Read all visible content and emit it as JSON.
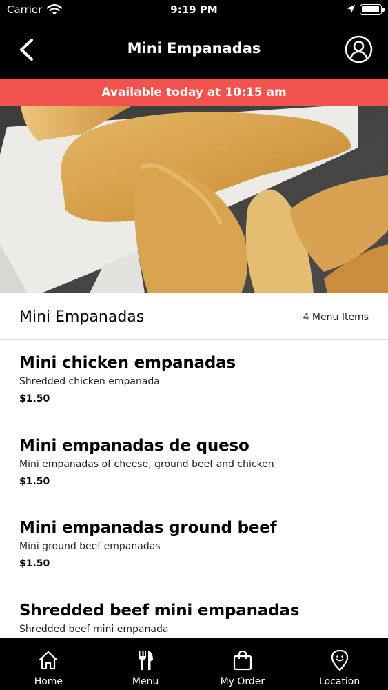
{
  "status_bar": {
    "carrier": "Carrier",
    "time": "9:19 PM"
  },
  "nav": {
    "title": "Mini Empanadas",
    "back_icon": "chevron-left-icon",
    "profile_icon": "user-circle-icon"
  },
  "banner": {
    "text": "Available today at 10:15 am",
    "color": "#f2534f"
  },
  "section": {
    "title": "Mini Empanadas",
    "count": "4 Menu Items"
  },
  "items": [
    {
      "name": "Mini chicken empanadas",
      "description": "Shredded chicken empanada",
      "price": "$1.50"
    },
    {
      "name": "Mini empanadas de queso",
      "description": "Mini empanadas of cheese, ground beef and chicken",
      "price": "$1.50"
    },
    {
      "name": "Mini empanadas ground beef",
      "description": "Mini ground beef empanadas",
      "price": "$1.50"
    },
    {
      "name": "Shredded beef mini empanadas",
      "description": "Shredded beef mini empanada",
      "price": ""
    }
  ],
  "tabs": [
    {
      "label": "Home",
      "icon": "home-icon"
    },
    {
      "label": "Menu",
      "icon": "fork-knife-icon"
    },
    {
      "label": "My Order",
      "icon": "shopping-bag-icon"
    },
    {
      "label": "Location",
      "icon": "location-pin-icon"
    }
  ]
}
